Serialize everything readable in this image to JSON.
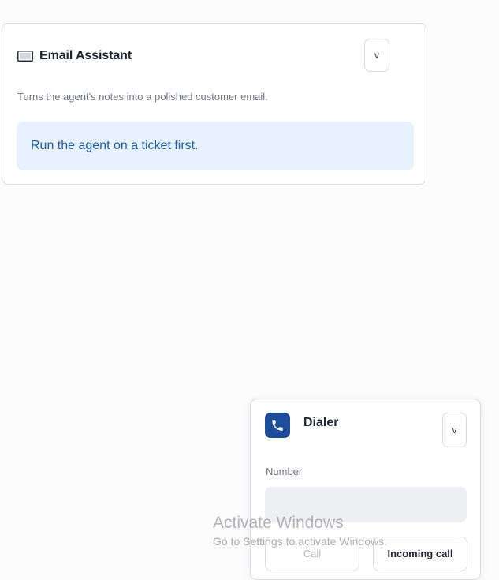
{
  "email_assistant": {
    "icon": "envelope-icon",
    "title": "Email Assistant",
    "collapse_label": "v",
    "description": "Turns the agent's notes into a polished customer email.",
    "info_message": "Run the agent on a ticket first."
  },
  "dialer": {
    "icon": "phone-icon",
    "title": "Dialer",
    "collapse_label": "v",
    "number_label": "Number",
    "number_value": "",
    "call_label": "Call",
    "incoming_label": "Incoming call"
  },
  "watermark": {
    "title": "Activate Windows",
    "subtitle": "Go to Settings to activate Windows."
  },
  "colors": {
    "accent": "#1f4d9e",
    "info_bg": "#e8f1fe",
    "info_text": "#1f5ca3"
  }
}
